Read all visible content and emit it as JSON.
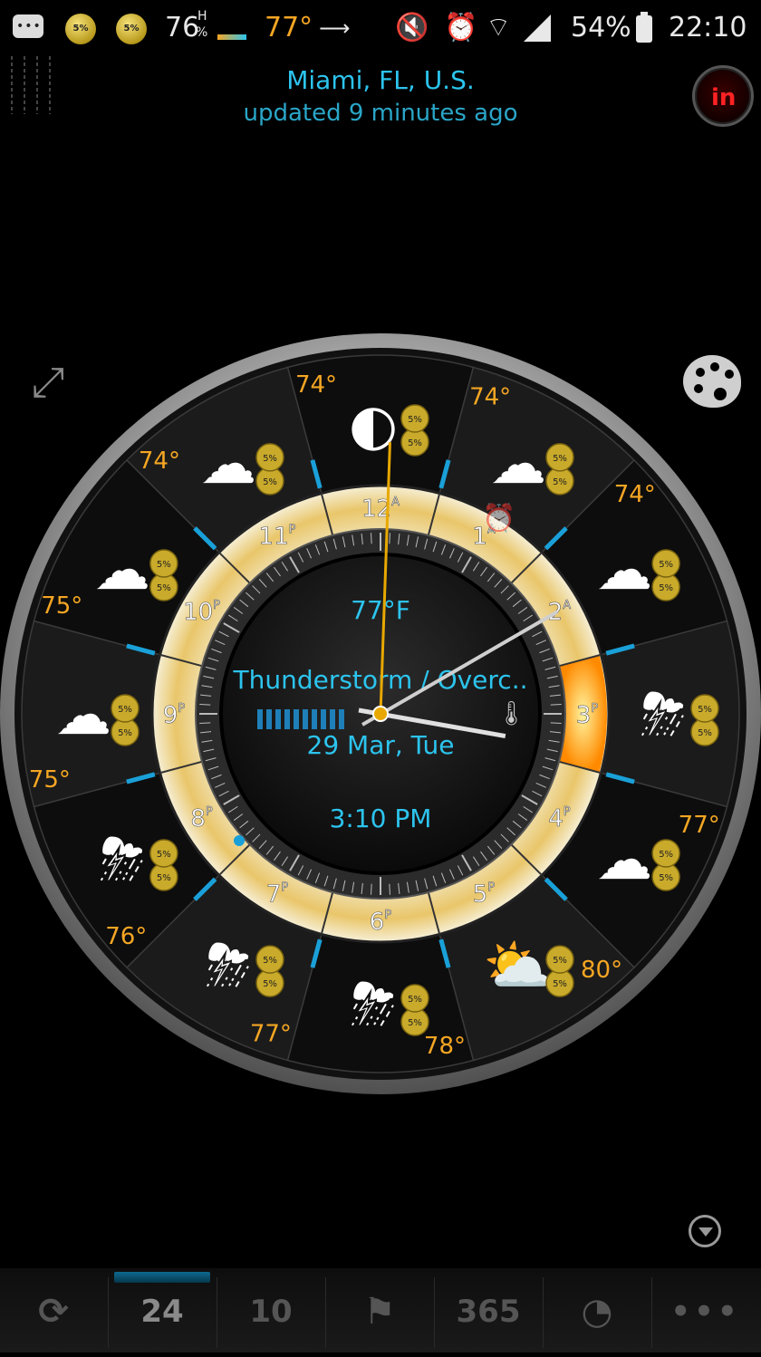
{
  "status_bar": {
    "chip_label": "5%",
    "humidity_temp": "76",
    "humidity_sup": "H",
    "humidity_unit": "%",
    "current_temp": "77°",
    "wind_arrow": "⟶",
    "battery": "54%",
    "time": "22:10",
    "icons": [
      "messages-icon",
      "weather-chip-icon",
      "wind-chip-icon",
      "mute-icon",
      "alarm-icon",
      "wifi-icon",
      "signal-icon",
      "battery-charging-icon"
    ]
  },
  "header": {
    "location": "Miami, FL, U.S.",
    "updated": "updated 9 minutes ago"
  },
  "clock": {
    "temperature": "77°F",
    "condition": "Thunderstorm / Overc..",
    "date": "29 Mar, Tue",
    "time": "3:10 PM",
    "hour_labels": [
      "12",
      "1",
      "2",
      "3",
      "4",
      "5",
      "6",
      "7",
      "8",
      "9",
      "10",
      "11"
    ],
    "hour_suffix": [
      "A",
      "A",
      "A",
      "P",
      "P",
      "P",
      "P",
      "P",
      "P",
      "P",
      "P",
      "P"
    ],
    "chip_label": "5%",
    "hand_hour": 15.17,
    "hand_minute": 10,
    "colors": {
      "accent": "#2cc4ee",
      "temp": "#f5a623",
      "ring": "#f0e2b0",
      "hot": "#ff9a00"
    }
  },
  "forecast": [
    {
      "temp": "74°",
      "icon": "moon-icon"
    },
    {
      "temp": "74°",
      "icon": "moon-cloud-icon"
    },
    {
      "temp": "74°",
      "icon": "cloud-icon"
    },
    {
      "temp": "",
      "icon": "thunderstorm-icon"
    },
    {
      "temp": "77°",
      "icon": "cloud-icon"
    },
    {
      "temp": "80°",
      "icon": "sun-cloud-icon"
    },
    {
      "temp": "78°",
      "icon": "thunderstorm-icon"
    },
    {
      "temp": "77°",
      "icon": "sun-storm-icon"
    },
    {
      "temp": "76°",
      "icon": "moon-storm-icon"
    },
    {
      "temp": "75°",
      "icon": "cloud-icon"
    },
    {
      "temp": "75°",
      "icon": "cloud-icon"
    },
    {
      "temp": "74°",
      "icon": "moon-cloud-icon"
    }
  ],
  "bottom_nav": {
    "items": [
      {
        "label": "",
        "icon": "refresh-icon"
      },
      {
        "label": "24",
        "icon": ""
      },
      {
        "label": "10",
        "icon": ""
      },
      {
        "label": "",
        "icon": "person-flag-icon"
      },
      {
        "label": "365",
        "icon": ""
      },
      {
        "label": "",
        "icon": "rss-icon"
      },
      {
        "label": "•••",
        "icon": "more-icon"
      }
    ]
  }
}
